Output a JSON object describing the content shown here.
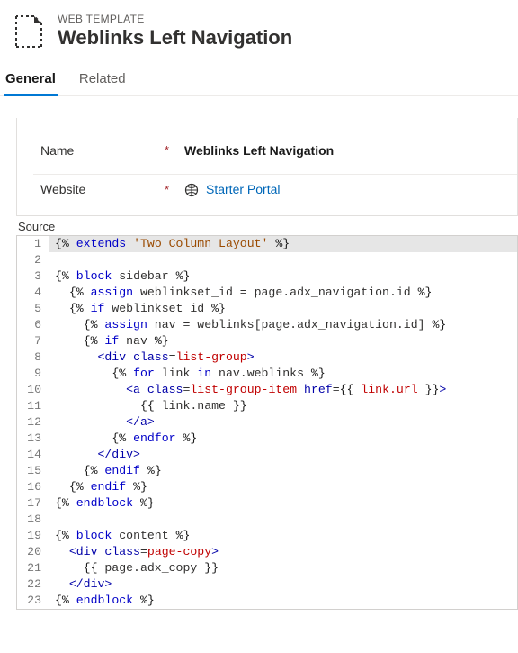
{
  "header": {
    "breadcrumb": "WEB TEMPLATE",
    "title": "Weblinks Left Navigation"
  },
  "tabs": {
    "general": "General",
    "related": "Related"
  },
  "form": {
    "name_label": "Name",
    "name_value": "Weblinks Left Navigation",
    "website_label": "Website",
    "website_value": "Starter Portal",
    "required_mark": "*"
  },
  "source": {
    "label": "Source",
    "lines": [
      [
        [
          "delim",
          "{%"
        ],
        [
          "plain",
          " "
        ],
        [
          "kw",
          "extends"
        ],
        [
          "plain",
          " "
        ],
        [
          "str",
          "'Two Column Layout'"
        ],
        [
          "plain",
          " "
        ],
        [
          "delim",
          "%}"
        ]
      ],
      [],
      [
        [
          "delim",
          "{%"
        ],
        [
          "plain",
          " "
        ],
        [
          "kw",
          "block"
        ],
        [
          "plain",
          " sidebar "
        ],
        [
          "delim",
          "%}"
        ]
      ],
      [
        [
          "plain",
          "  "
        ],
        [
          "delim",
          "{%"
        ],
        [
          "plain",
          " "
        ],
        [
          "kw",
          "assign"
        ],
        [
          "plain",
          " weblinkset_id = page.adx_navigation.id "
        ],
        [
          "delim",
          "%}"
        ]
      ],
      [
        [
          "plain",
          "  "
        ],
        [
          "delim",
          "{%"
        ],
        [
          "plain",
          " "
        ],
        [
          "kw",
          "if"
        ],
        [
          "plain",
          " weblinkset_id "
        ],
        [
          "delim",
          "%}"
        ]
      ],
      [
        [
          "plain",
          "    "
        ],
        [
          "delim",
          "{%"
        ],
        [
          "plain",
          " "
        ],
        [
          "kw",
          "assign"
        ],
        [
          "plain",
          " nav = weblinks[page.adx_navigation.id] "
        ],
        [
          "delim",
          "%}"
        ]
      ],
      [
        [
          "plain",
          "    "
        ],
        [
          "delim",
          "{%"
        ],
        [
          "plain",
          " "
        ],
        [
          "kw",
          "if"
        ],
        [
          "plain",
          " nav "
        ],
        [
          "delim",
          "%}"
        ]
      ],
      [
        [
          "plain",
          "      "
        ],
        [
          "tag",
          "<div"
        ],
        [
          "plain",
          " "
        ],
        [
          "tag",
          "class"
        ],
        [
          "plain",
          "="
        ],
        [
          "attr",
          "list-group"
        ],
        [
          "tag",
          ">"
        ]
      ],
      [
        [
          "plain",
          "        "
        ],
        [
          "delim",
          "{%"
        ],
        [
          "plain",
          " "
        ],
        [
          "kw",
          "for"
        ],
        [
          "plain",
          " link "
        ],
        [
          "kw",
          "in"
        ],
        [
          "plain",
          " nav.weblinks "
        ],
        [
          "delim",
          "%}"
        ]
      ],
      [
        [
          "plain",
          "          "
        ],
        [
          "tag",
          "<a"
        ],
        [
          "plain",
          " "
        ],
        [
          "tag",
          "class"
        ],
        [
          "plain",
          "="
        ],
        [
          "attr",
          "list-group-item"
        ],
        [
          "plain",
          " "
        ],
        [
          "tag",
          "href"
        ],
        [
          "plain",
          "="
        ],
        [
          "delim",
          "{{"
        ],
        [
          "plain",
          " "
        ],
        [
          "attr",
          "link.url"
        ],
        [
          "plain",
          " "
        ],
        [
          "delim",
          "}}"
        ],
        [
          "tag",
          ">"
        ]
      ],
      [
        [
          "plain",
          "            "
        ],
        [
          "delim",
          "{{"
        ],
        [
          "plain",
          " link.name "
        ],
        [
          "delim",
          "}}"
        ]
      ],
      [
        [
          "plain",
          "          "
        ],
        [
          "tag",
          "</a>"
        ]
      ],
      [
        [
          "plain",
          "        "
        ],
        [
          "delim",
          "{%"
        ],
        [
          "plain",
          " "
        ],
        [
          "kw",
          "endfor"
        ],
        [
          "plain",
          " "
        ],
        [
          "delim",
          "%}"
        ]
      ],
      [
        [
          "plain",
          "      "
        ],
        [
          "tag",
          "</div>"
        ]
      ],
      [
        [
          "plain",
          "    "
        ],
        [
          "delim",
          "{%"
        ],
        [
          "plain",
          " "
        ],
        [
          "kw",
          "endif"
        ],
        [
          "plain",
          " "
        ],
        [
          "delim",
          "%}"
        ]
      ],
      [
        [
          "plain",
          "  "
        ],
        [
          "delim",
          "{%"
        ],
        [
          "plain",
          " "
        ],
        [
          "kw",
          "endif"
        ],
        [
          "plain",
          " "
        ],
        [
          "delim",
          "%}"
        ]
      ],
      [
        [
          "delim",
          "{%"
        ],
        [
          "plain",
          " "
        ],
        [
          "kw",
          "endblock"
        ],
        [
          "plain",
          " "
        ],
        [
          "delim",
          "%}"
        ]
      ],
      [],
      [
        [
          "delim",
          "{%"
        ],
        [
          "plain",
          " "
        ],
        [
          "kw",
          "block"
        ],
        [
          "plain",
          " content "
        ],
        [
          "delim",
          "%}"
        ]
      ],
      [
        [
          "plain",
          "  "
        ],
        [
          "tag",
          "<div"
        ],
        [
          "plain",
          " "
        ],
        [
          "tag",
          "class"
        ],
        [
          "plain",
          "="
        ],
        [
          "attr",
          "page-copy"
        ],
        [
          "tag",
          ">"
        ]
      ],
      [
        [
          "plain",
          "    "
        ],
        [
          "delim",
          "{{"
        ],
        [
          "plain",
          " page.adx_copy "
        ],
        [
          "delim",
          "}}"
        ]
      ],
      [
        [
          "plain",
          "  "
        ],
        [
          "tag",
          "</div>"
        ]
      ],
      [
        [
          "delim",
          "{%"
        ],
        [
          "plain",
          " "
        ],
        [
          "kw",
          "endblock"
        ],
        [
          "plain",
          " "
        ],
        [
          "delim",
          "%}"
        ]
      ]
    ]
  }
}
